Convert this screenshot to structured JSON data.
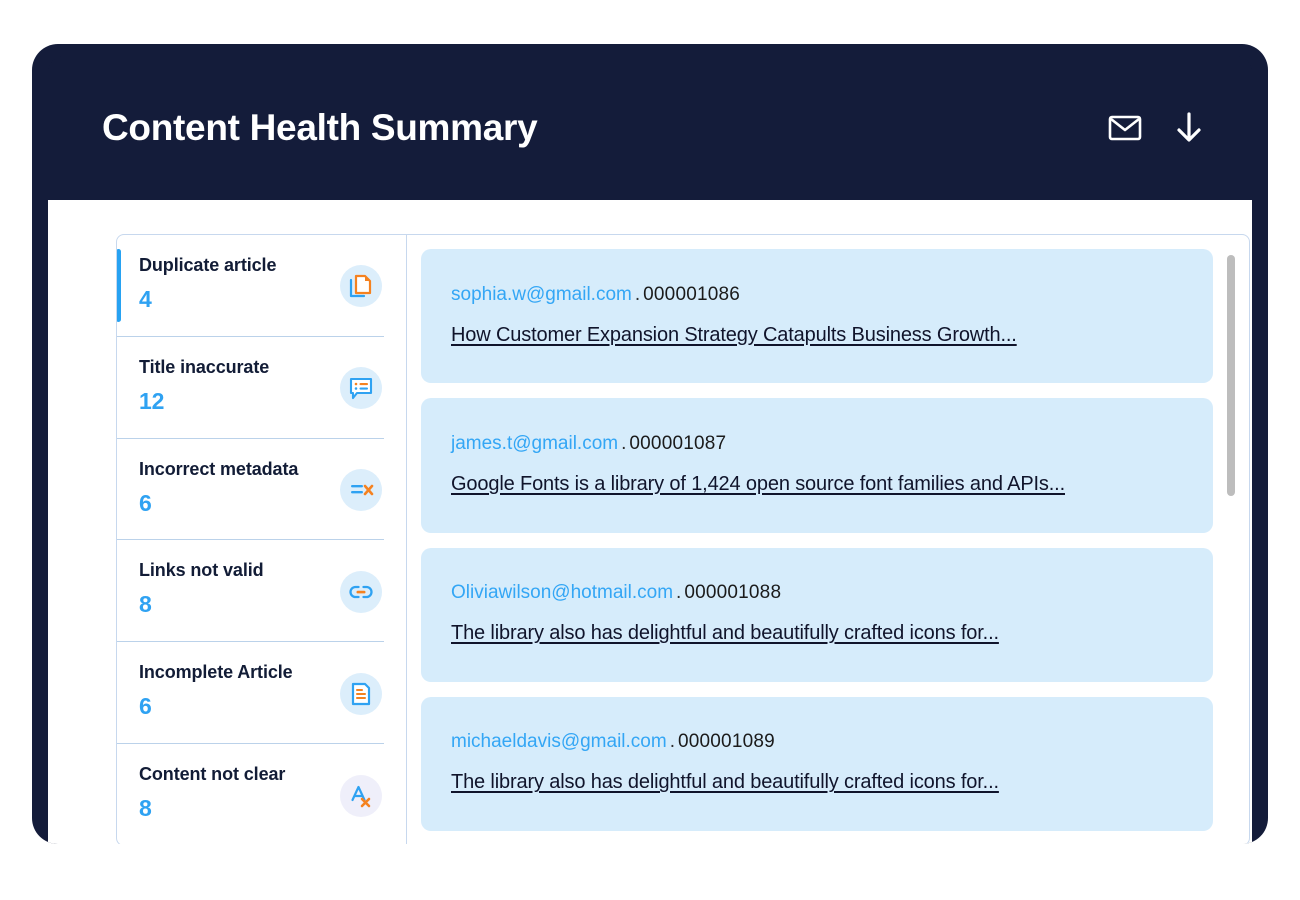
{
  "header": {
    "title": "Content Health Summary",
    "actions": [
      {
        "name": "email-icon",
        "label": "Email"
      },
      {
        "name": "download-icon",
        "label": "Download"
      }
    ]
  },
  "colors": {
    "frame": "#141C3A",
    "accent_blue": "#2FA2F2",
    "accent_orange": "#F58220",
    "card_bg": "#D6ECFB",
    "icon_bg": "#DCEEFB",
    "icon_bg_alt": "#EFEFFA",
    "divider": "#C7D8EE",
    "scrollbar": "#BDBDBD"
  },
  "sidebar": {
    "items": [
      {
        "label": "Duplicate article",
        "count": "4",
        "icon": "duplicate-document-icon",
        "active": true
      },
      {
        "label": "Title inaccurate",
        "count": "12",
        "icon": "comment-list-icon",
        "active": false
      },
      {
        "label": "Incorrect metadata",
        "count": "6",
        "icon": "metadata-error-icon",
        "active": false
      },
      {
        "label": "Links not valid",
        "count": "8",
        "icon": "broken-link-icon",
        "active": false
      },
      {
        "label": "Incomplete Article",
        "count": "6",
        "icon": "document-lines-icon",
        "active": false
      },
      {
        "label": "Content not clear",
        "count": "8",
        "icon": "spelling-error-icon",
        "active": false
      }
    ]
  },
  "articles": {
    "items": [
      {
        "email": "sophia.w@gmail.com",
        "separator": ".",
        "id": "000001086",
        "title": "How Customer Expansion Strategy Catapults Business Growth..."
      },
      {
        "email": "james.t@gmail.com",
        "separator": ".",
        "id": "000001087",
        "title": "Google Fonts is a library of 1,424 open source font families and APIs..."
      },
      {
        "email": "Oliviawilson@hotmail.com",
        "separator": ".",
        "id": "000001088",
        "title": "The library also has delightful and beautifully crafted icons for..."
      },
      {
        "email": "michaeldavis@gmail.com",
        "separator": ".",
        "id": "000001089",
        "title": "The library also has delightful and beautifully crafted icons for..."
      }
    ]
  }
}
